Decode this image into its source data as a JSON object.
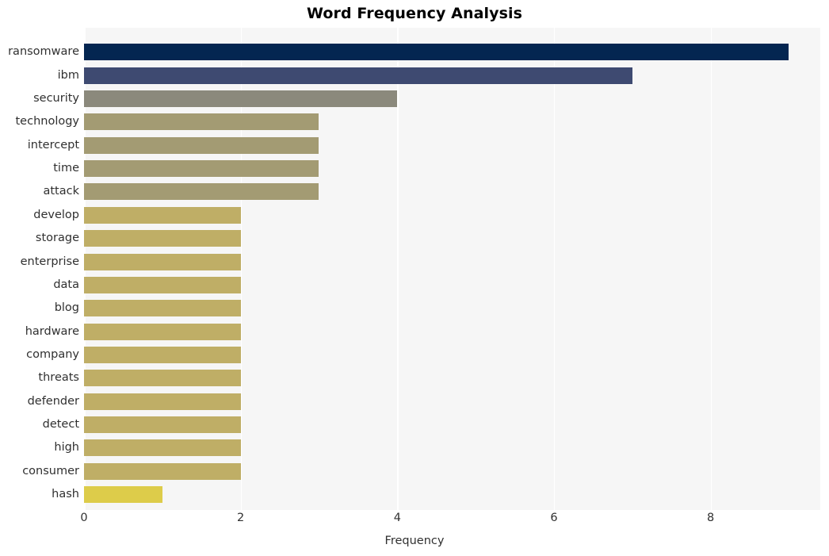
{
  "chart_data": {
    "type": "bar",
    "orientation": "horizontal",
    "title": "Word Frequency Analysis",
    "xlabel": "Frequency",
    "ylabel": "",
    "categories": [
      "ransomware",
      "ibm",
      "security",
      "technology",
      "intercept",
      "time",
      "attack",
      "develop",
      "storage",
      "enterprise",
      "data",
      "blog",
      "hardware",
      "company",
      "threats",
      "defender",
      "detect",
      "high",
      "consumer",
      "hash"
    ],
    "values": [
      9,
      7,
      4,
      3,
      3,
      3,
      3,
      2,
      2,
      2,
      2,
      2,
      2,
      2,
      2,
      2,
      2,
      2,
      2,
      1
    ],
    "bar_colors": [
      "#042651",
      "#3e4a71",
      "#8b897c",
      "#a39b73",
      "#a39b73",
      "#a39b73",
      "#a39b73",
      "#bfae66",
      "#bfae66",
      "#bfae66",
      "#bfae66",
      "#bfae66",
      "#bfae66",
      "#bfae66",
      "#bfae66",
      "#bfae66",
      "#bfae66",
      "#bfae66",
      "#bfae66",
      "#ddcc4a"
    ],
    "xticks": [
      0,
      2,
      4,
      6,
      8
    ],
    "xtick_labels": [
      "0",
      "2",
      "4",
      "6",
      "8"
    ],
    "xlim": [
      0,
      9.4
    ],
    "grid": true,
    "grid_color": "#ffffff",
    "plot_background": "#f6f6f6",
    "figure_background": "#ffffff",
    "legend": null
  }
}
